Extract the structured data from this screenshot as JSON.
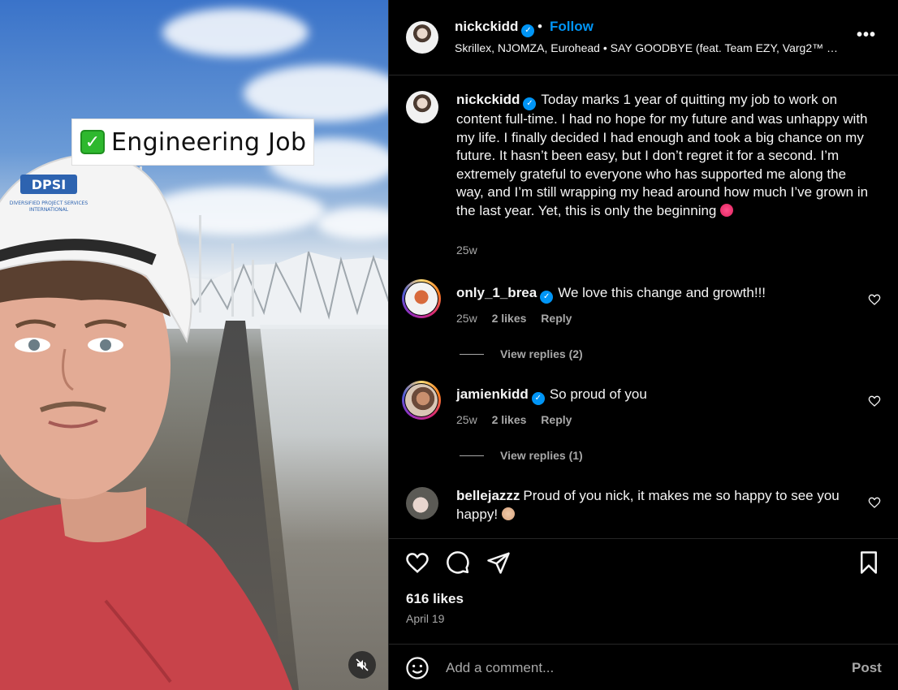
{
  "media": {
    "overlay_label": "Engineering Job",
    "overlay_icon": "check-mark-icon",
    "hardhat_text": "DPSI",
    "hardhat_subtext": "DIVERSIFIED PROJECT SERVICES INTERNATIONAL",
    "mute_icon": "speaker-muted-icon"
  },
  "header": {
    "username": "nickckidd",
    "separator": "•",
    "follow_label": "Follow",
    "audio": "Skrillex, NJOMZA, Eurohead • SAY GOODBYE (feat. Team EZY, Varg2™ …",
    "more_label": "•••"
  },
  "caption": {
    "username": "nickckidd",
    "text": "Today marks 1 year of quitting my job to work on content full-time. I had no hope for my future and was unhappy with my life. I finally decided I had enough and took a big chance on my future. It hasn’t been easy, but I don’t regret it for a second. I’m extremely grateful to everyone who has supported me along the way, and I’m still wrapping my head around how much I’ve grown in the last year. Yet, this is only the beginning",
    "age": "25w"
  },
  "comments": [
    {
      "username": "only_1_brea",
      "text": "We love this change and growth!!!",
      "age": "25w",
      "likes": "2 likes",
      "reply": "Reply",
      "view_replies": "View replies (2)"
    },
    {
      "username": "jamienkidd",
      "text": "So proud of you",
      "age": "25w",
      "likes": "2 likes",
      "reply": "Reply",
      "view_replies": "View replies (1)"
    },
    {
      "username": "bellejazzz",
      "text": "Proud of you nick, it makes me so happy to see you happy!"
    }
  ],
  "actions": {
    "likes": "616 likes",
    "date": "April 19"
  },
  "add_comment": {
    "placeholder": "Add a comment...",
    "post_label": "Post"
  },
  "colors": {
    "background": "#000000",
    "text": "#f5f5f5",
    "secondary": "#a8a8a8",
    "accent": "#0095f6",
    "divider": "#262626"
  }
}
